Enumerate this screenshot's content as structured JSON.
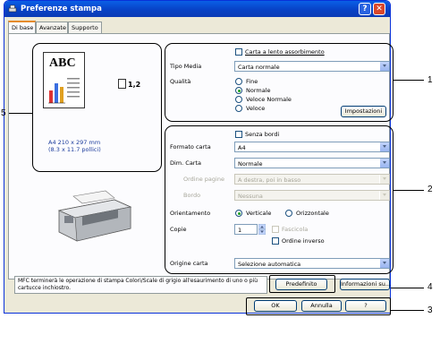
{
  "window": {
    "title": "Preferenze stampa",
    "help_btn": "?",
    "close_btn": "✕"
  },
  "tabs": [
    {
      "label": "Di base",
      "active": true
    },
    {
      "label": "Avanzate",
      "active": false
    },
    {
      "label": "Supporto",
      "active": false
    }
  ],
  "preview": {
    "abc": "ABC",
    "copies_label": "1,2",
    "paper_size": "A4 210 x 297 mm",
    "paper_size_inches": "(8.3 x 11.7 pollici)"
  },
  "media": {
    "slow_dry_checkbox": "Carta a lento assorbimento",
    "media_type_label": "Tipo Media",
    "media_type_value": "Carta normale",
    "quality_label": "Qualità",
    "quality_options": [
      "Fine",
      "Normale",
      "Veloce Normale",
      "Veloce"
    ],
    "quality_selected": "Normale",
    "settings_button": "Impostazioni"
  },
  "paper": {
    "borderless_checkbox": "Senza bordi",
    "paper_format_label": "Formato carta",
    "paper_format_value": "A4",
    "page_layout_label": "Dim. Carta",
    "page_layout_value": "Normale",
    "page_order_label": "Ordine pagine",
    "page_order_value": "A destra, poi in basso",
    "border_label": "Bordo",
    "border_value": "Nessuna",
    "orientation_label": "Orientamento",
    "orientation_options": [
      "Verticale",
      "Orizzontale"
    ],
    "orientation_selected": "Verticale",
    "copies_label": "Copie",
    "copies_value": "1",
    "collate_checkbox": "Fascicola",
    "reverse_order_checkbox": "Ordine inverso",
    "paper_source_label": "Origine carta",
    "paper_source_value": "Selezione automatica"
  },
  "footer": {
    "message": "MFC terminerà le operazione di stampa Colori/Scale di grigio all'esaurimento di uno o più cartucce inchiostro.",
    "default_button": "Predefinito",
    "info_button": "Informazioni su...",
    "ok_button": "OK",
    "cancel_button": "Annulla",
    "help_button": "?"
  },
  "callouts": {
    "c1": "1",
    "c2": "2",
    "c3": "3",
    "c4": "4",
    "c5": "5"
  }
}
